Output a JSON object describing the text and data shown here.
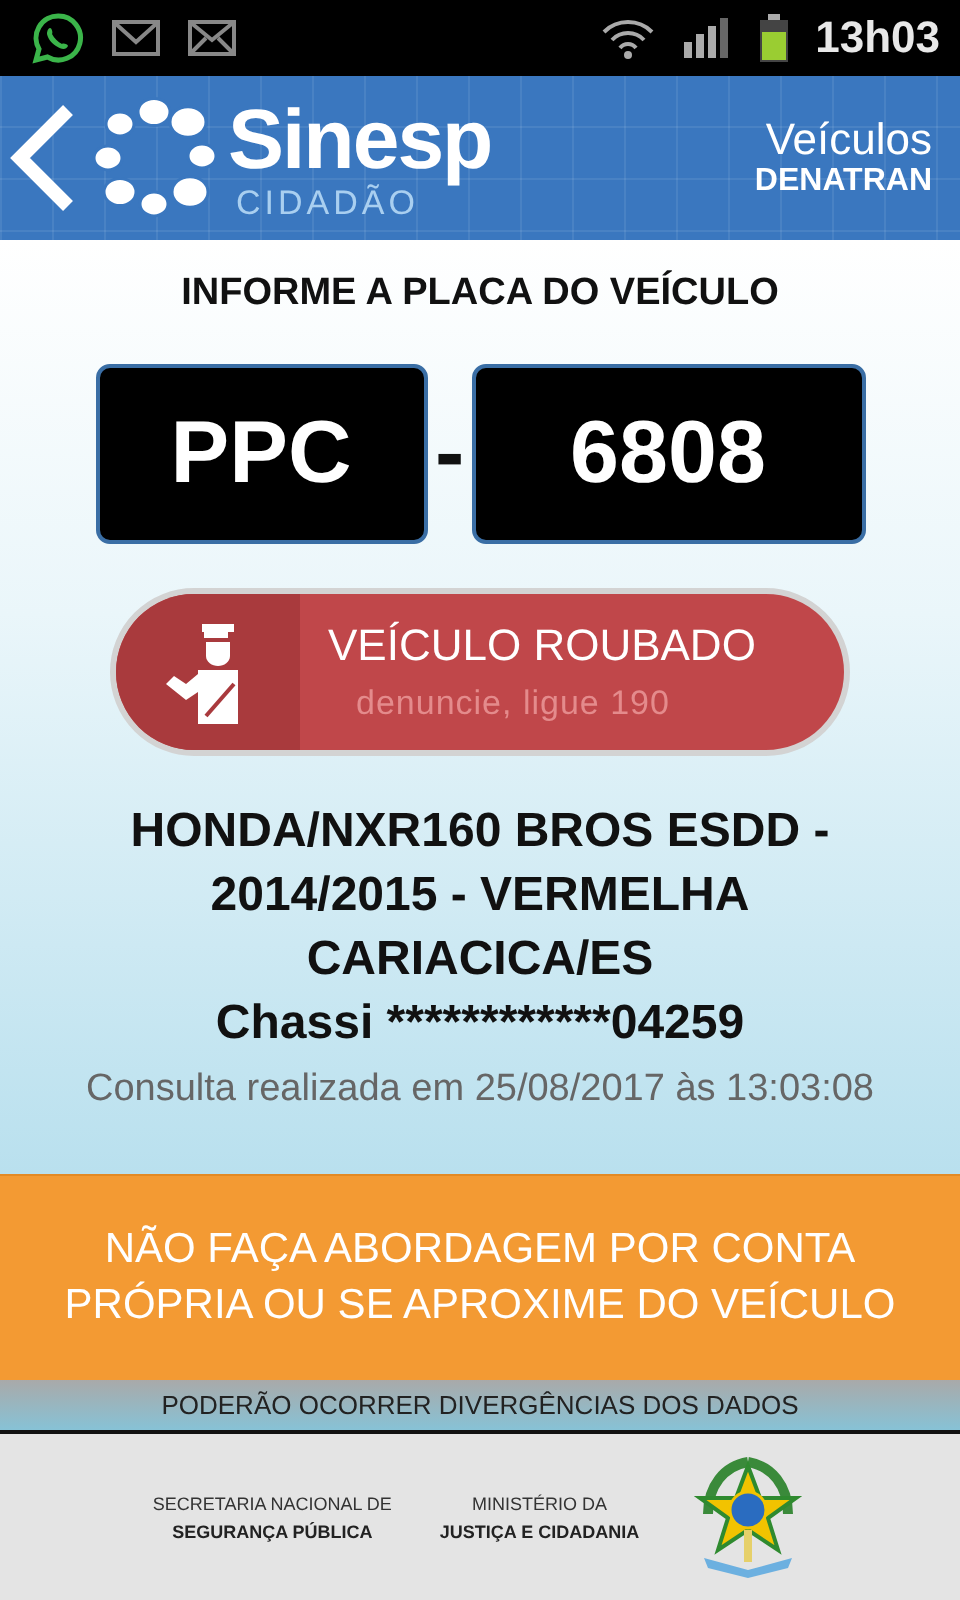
{
  "status_bar": {
    "time": "13h03"
  },
  "header": {
    "logo_title": "Sinesp",
    "logo_subtitle": "CIDADÃO",
    "section": "Veículos",
    "agency": "DENATRAN"
  },
  "plate": {
    "prompt": "INFORME A PLACA DO VEÍCULO",
    "letters": "PPC",
    "separator": "-",
    "numbers": "6808"
  },
  "alert": {
    "title": "VEÍCULO ROUBADO",
    "subtitle": "denuncie, ligue 190"
  },
  "vehicle": {
    "lines": [
      "HONDA/NXR160 BROS ESDD -",
      "2014/2015 - VERMELHA",
      "CARIACICA/ES"
    ],
    "chassis": "Chassi ************04259",
    "query": "Consulta realizada em 25/08/2017 às 13:03:08"
  },
  "warning": "NÃO FAÇA ABORDAGEM POR CONTA PRÓPRIA OU SE APROXIME DO VEÍCULO",
  "disclaimer": "PODERÃO OCORRER DIVERGÊNCIAS DOS DADOS",
  "footer": {
    "blocks": [
      {
        "line1": "SECRETARIA NACIONAL DE",
        "line2": "SEGURANÇA PÚBLICA"
      },
      {
        "line1": "MINISTÉRIO DA",
        "line2": "JUSTIÇA E CIDADANIA"
      }
    ]
  }
}
